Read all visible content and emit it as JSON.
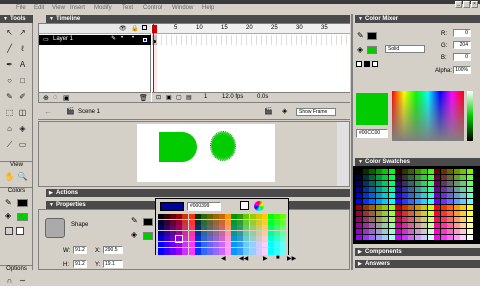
{
  "menubar": {
    "items": [
      "File",
      "Edit",
      "View",
      "Insert",
      "Modify",
      "Text",
      "Control",
      "Window",
      "Help"
    ]
  },
  "tools": {
    "title": "Tools",
    "view_title": "View",
    "colors_title": "Colors",
    "options_title": "Options",
    "tool_icons": [
      "arrow-icon",
      "subselect-icon",
      "line-icon",
      "lasso-icon",
      "pen-icon",
      "text-icon",
      "oval-icon",
      "rectangle-icon",
      "pencil-icon",
      "brush-icon",
      "free-transform-icon",
      "fill-transform-icon",
      "ink-bottle-icon",
      "paint-bucket-icon",
      "eyedropper-icon",
      "eraser-icon",
      "hand-icon",
      "zoom-icon"
    ]
  },
  "timeline": {
    "title": "Timeline",
    "layer_name": "Layer 1",
    "frame_numbers": [
      "5",
      "10",
      "15",
      "20",
      "25",
      "30",
      "35"
    ],
    "frame_current": "1",
    "fps": "12.0 fps",
    "time": "0.0s"
  },
  "stage": {
    "scene_name": "Scene 1",
    "zoom_dropdown": "Show Frame"
  },
  "panels": {
    "actions_title": "Actions",
    "properties_title": "Properties",
    "shape_label": "Shape",
    "w_label": "W:",
    "w_value": "91.2",
    "h_label": "H:",
    "h_value": "91.2",
    "x_label": "X:",
    "x_value": "290.5",
    "y_label": "Y:",
    "y_value": "19.1"
  },
  "color_popup": {
    "hex_value": "#000399"
  },
  "color_mixer": {
    "title": "Color Mixer",
    "fill_type": "Solid",
    "r_label": "R:",
    "r_value": "0",
    "g_label": "G:",
    "g_value": "204",
    "b_label": "B:",
    "b_value": "0",
    "alpha_label": "Alpha:",
    "alpha_value": "100%",
    "hex": "#00CC00"
  },
  "color_swatches": {
    "title": "Color Swatches"
  },
  "components": {
    "title": "Components"
  },
  "answers": {
    "title": "Answers"
  },
  "colors": {
    "fill_green": "#00cc00",
    "panel_dark": "#4a4a4a",
    "playhead_red": "#cc0000"
  }
}
